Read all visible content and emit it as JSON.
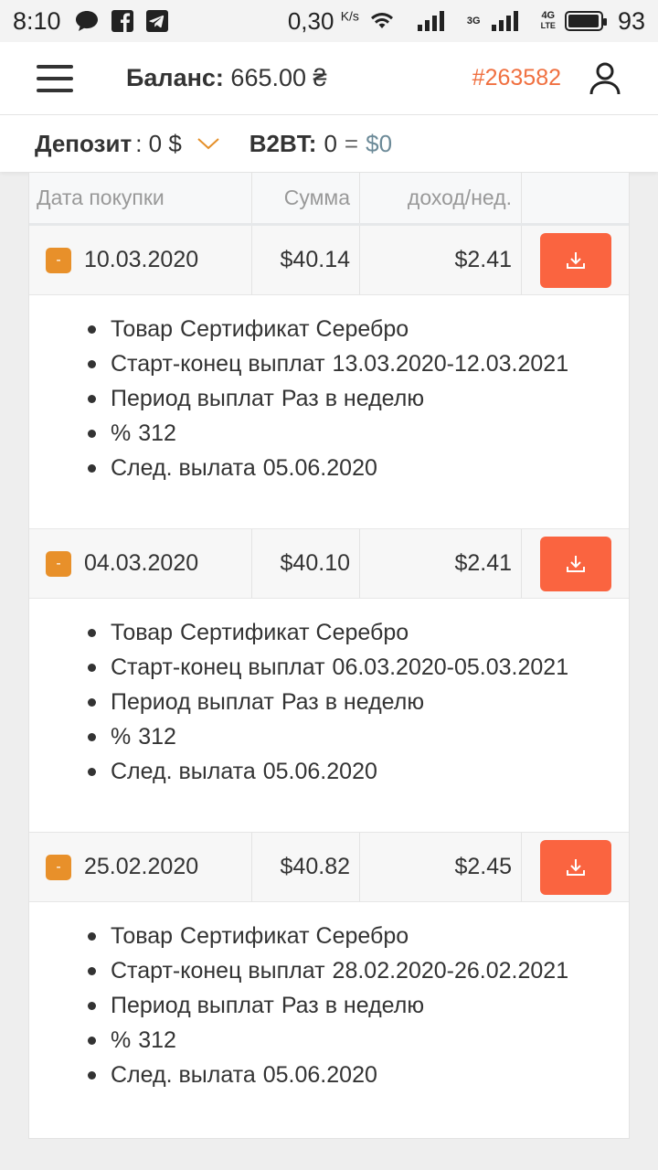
{
  "status_bar": {
    "time": "8:10",
    "speed": "0,30",
    "speed_unit": "K/s",
    "net_3g": "3G",
    "net_4g": "4G",
    "net_lte": "LTE",
    "battery": "93"
  },
  "header": {
    "balance_label": "Баланс:",
    "balance_value": "665.00 ₴",
    "account_id": "#263582"
  },
  "deposit_bar": {
    "deposit_label": "Депозит",
    "deposit_value": ": 0 $",
    "b2bt_label": "B2BT:",
    "b2bt_value": "0",
    "equals": "=",
    "b2bt_usd": "$0"
  },
  "table": {
    "headers": {
      "date": "Дата покупки",
      "amount": "Сумма",
      "income": "доход/нед."
    },
    "rows": [
      {
        "toggle": "-",
        "date": "10.03.2020",
        "amount": "$40.14",
        "income": "$2.41",
        "details": [
          {
            "label": "Товар",
            "value": "Сертификат Серебро"
          },
          {
            "label": "Старт-конец выплат",
            "value": "13.03.2020-12.03.2021"
          },
          {
            "label": "Период выплат",
            "value": "Раз в неделю"
          },
          {
            "label": "%",
            "value": "312"
          },
          {
            "label": "След. вылата",
            "value": "05.06.2020"
          }
        ]
      },
      {
        "toggle": "-",
        "date": "04.03.2020",
        "amount": "$40.10",
        "income": "$2.41",
        "details": [
          {
            "label": "Товар",
            "value": "Сертификат Серебро"
          },
          {
            "label": "Старт-конец выплат",
            "value": "06.03.2020-05.03.2021"
          },
          {
            "label": "Период выплат",
            "value": "Раз в неделю"
          },
          {
            "label": "%",
            "value": "312"
          },
          {
            "label": "След. вылата",
            "value": "05.06.2020"
          }
        ]
      },
      {
        "toggle": "-",
        "date": "25.02.2020",
        "amount": "$40.82",
        "income": "$2.45",
        "details": [
          {
            "label": "Товар",
            "value": "Сертификат Серебро"
          },
          {
            "label": "Старт-конец выплат",
            "value": "28.02.2020-26.02.2021"
          },
          {
            "label": "Период выплат",
            "value": "Раз в неделю"
          },
          {
            "label": "%",
            "value": "312"
          },
          {
            "label": "След. вылата",
            "value": "05.06.2020"
          }
        ]
      }
    ]
  },
  "colors": {
    "accent": "#fa6440",
    "toggle": "#e8902a",
    "account": "#f07040"
  },
  "icons": {
    "menu": "hamburger-icon",
    "user": "user-icon",
    "download": "download-icon",
    "chevron": "chevron-down-icon"
  }
}
